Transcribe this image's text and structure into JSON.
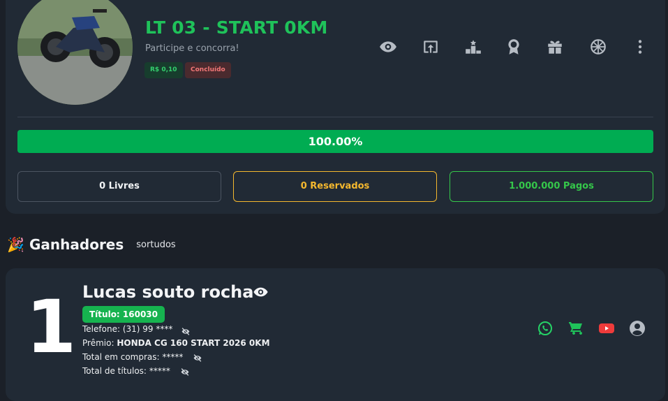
{
  "raffle": {
    "title": "LT 03 - START 0KM",
    "subtitle": "Participe e concorra!",
    "price_badge": "R$ 0,10",
    "status_badge": "Concluído",
    "image_alt": "Motocicleta Honda CG 160 Start"
  },
  "action_icons": [
    "eye-icon",
    "share-icon",
    "podium-icon",
    "award-icon",
    "gift-icon",
    "wheel-icon",
    "more-vertical-icon"
  ],
  "progress": {
    "value": 100,
    "label": "100.00%"
  },
  "stats": {
    "free": "0 Livres",
    "reserved": "0 Reservados",
    "paid": "1.000.000 Pagos"
  },
  "winners_section": {
    "emoji": "🎉",
    "title": "Ganhadores",
    "subtitle": "sortudos"
  },
  "winner": {
    "rank": "1",
    "name": "Lucas souto rocha",
    "ticket": "Título: 160030",
    "phone_label": "Telefone:",
    "phone_value": "(31) 99 ****",
    "prize_label": "Prêmio:",
    "prize_value": "HONDA CG 160 START 2026 0KM",
    "purchases_label": "Total em compras:",
    "purchases_value": "*****",
    "titles_label": "Total de títulos:",
    "titles_value": "*****"
  },
  "colors": {
    "accent": "#1fc25a",
    "progress": "#00ac52",
    "reserved": "#f5b82e",
    "paid": "#35c74a",
    "whatsapp": "#25d366",
    "cart": "#1fc25a",
    "youtube": "#ef3b3b"
  },
  "winner_actions": [
    "whatsapp-icon",
    "cart-icon",
    "youtube-icon",
    "user-icon"
  ]
}
